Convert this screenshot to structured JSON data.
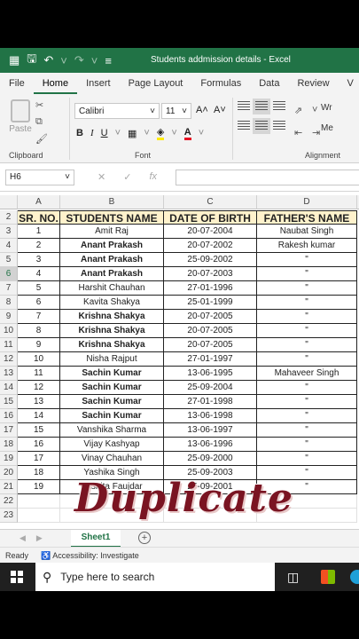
{
  "window": {
    "title": "Students addmission details  -  Excel"
  },
  "ribbon_tabs": [
    "File",
    "Home",
    "Insert",
    "Page Layout",
    "Formulas",
    "Data",
    "Review",
    "V"
  ],
  "active_tab": "Home",
  "ribbon": {
    "paste_label": "Paste",
    "font_name": "Calibri",
    "font_size": "11",
    "grow_font": "A˄",
    "shrink_font": "A˅",
    "bold": "B",
    "italic": "I",
    "underline": "U",
    "wrap_label": "Wr",
    "merge_label": "Me",
    "groups": {
      "clipboard": "Clipboard",
      "font": "Font",
      "alignment": "Alignment"
    }
  },
  "formula_bar": {
    "name_box": "H6",
    "fx": "fx",
    "content": ""
  },
  "columns": [
    "A",
    "B",
    "C",
    "D"
  ],
  "headers": [
    "SR. NO.",
    "STUDENTS NAME",
    "DATE OF BIRTH",
    "FATHER'S NAME"
  ],
  "rows": [
    {
      "num": "3",
      "sr": "1",
      "name": "Amit Raj",
      "dob": "20-07-2004",
      "father": "Naubat Singh",
      "bold": false
    },
    {
      "num": "4",
      "sr": "2",
      "name": "Anant Prakash",
      "dob": "20-07-2002",
      "father": "Rakesh kumar",
      "bold": true
    },
    {
      "num": "5",
      "sr": "3",
      "name": "Anant Prakash",
      "dob": "25-09-2002",
      "father": "\"",
      "bold": true
    },
    {
      "num": "6",
      "sr": "4",
      "name": "Anant Prakash",
      "dob": "20-07-2003",
      "father": "\"",
      "bold": true
    },
    {
      "num": "7",
      "sr": "5",
      "name": "Harshit Chauhan",
      "dob": "27-01-1996",
      "father": "\"",
      "bold": false
    },
    {
      "num": "8",
      "sr": "6",
      "name": "Kavita Shakya",
      "dob": "25-01-1999",
      "father": "\"",
      "bold": false
    },
    {
      "num": "9",
      "sr": "7",
      "name": "Krishna Shakya",
      "dob": "20-07-2005",
      "father": "\"",
      "bold": true
    },
    {
      "num": "10",
      "sr": "8",
      "name": "Krishna Shakya",
      "dob": "20-07-2005",
      "father": "\"",
      "bold": true
    },
    {
      "num": "11",
      "sr": "9",
      "name": "Krishna Shakya",
      "dob": "20-07-2005",
      "father": "\"",
      "bold": true
    },
    {
      "num": "12",
      "sr": "10",
      "name": "Nisha Rajput",
      "dob": "27-01-1997",
      "father": "\"",
      "bold": false
    },
    {
      "num": "13",
      "sr": "11",
      "name": "Sachin Kumar",
      "dob": "13-06-1995",
      "father": "Mahaveer Singh",
      "bold": true
    },
    {
      "num": "14",
      "sr": "12",
      "name": "Sachin Kumar",
      "dob": "25-09-2004",
      "father": "\"",
      "bold": true
    },
    {
      "num": "15",
      "sr": "13",
      "name": "Sachin Kumar",
      "dob": "27-01-1998",
      "father": "\"",
      "bold": true
    },
    {
      "num": "16",
      "sr": "14",
      "name": "Sachin Kumar",
      "dob": "13-06-1998",
      "father": "\"",
      "bold": true
    },
    {
      "num": "17",
      "sr": "15",
      "name": "Vanshika Sharma",
      "dob": "13-06-1997",
      "father": "\"",
      "bold": false
    },
    {
      "num": "18",
      "sr": "16",
      "name": "Vijay Kashyap",
      "dob": "13-06-1996",
      "father": "\"",
      "bold": false
    },
    {
      "num": "19",
      "sr": "17",
      "name": "Vinay Chauhan",
      "dob": "25-09-2000",
      "father": "\"",
      "bold": false
    },
    {
      "num": "20",
      "sr": "18",
      "name": "Yashika Singh",
      "dob": "25-09-2003",
      "father": "\"",
      "bold": false
    },
    {
      "num": "21",
      "sr": "19",
      "name": "Yashita Faujdar",
      "dob": "25-09-2001",
      "father": "\"",
      "bold": false
    }
  ],
  "header_row_num": "2",
  "empty_rows": [
    "22",
    "23"
  ],
  "overlay_text": "Duplicate",
  "sheet_tab": "Sheet1",
  "status": {
    "ready": "Ready",
    "accessibility": "Accessibility: Investigate"
  },
  "taskbar": {
    "search_placeholder": "Type here to search"
  },
  "colors": {
    "excel_green": "#217346",
    "header_fill": "#fff2cc",
    "overlay": "#7a1422"
  }
}
